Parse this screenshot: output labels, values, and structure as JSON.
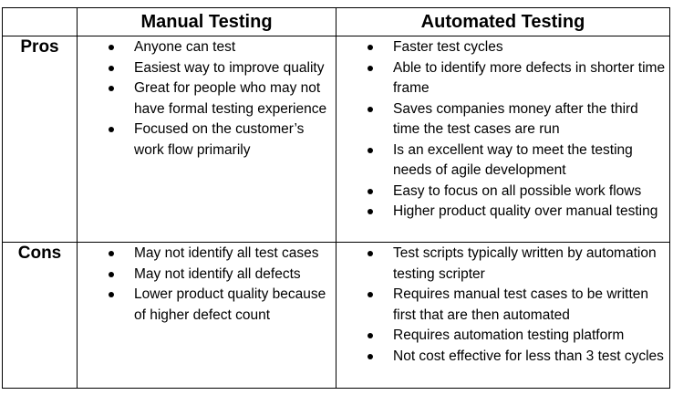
{
  "table": {
    "headers": {
      "manual": "Manual Testing",
      "automated": "Automated Testing"
    },
    "rows": {
      "pros": {
        "label": "Pros",
        "manual": [
          "Anyone can test",
          "Easiest way to improve quality",
          "Great for people who may not have formal testing experience",
          "Focused on the customer’s work flow primarily"
        ],
        "automated": [
          "Faster test cycles",
          "Able to identify more defects in shorter time frame",
          "Saves companies money after the third time the test cases are run",
          "Is an excellent way to meet the testing needs of agile development",
          "Easy to focus on all possible work flows",
          "Higher product quality over manual testing"
        ]
      },
      "cons": {
        "label": "Cons",
        "manual": [
          "May not identify all test cases",
          "May not identify all defects",
          "Lower product quality because of higher defect count"
        ],
        "automated": [
          "Test scripts typically written by automation testing scripter",
          "Requires manual test cases to be written first that are then automated",
          "Requires automation testing platform",
          "Not cost effective for less than 3 test cycles"
        ]
      }
    }
  }
}
